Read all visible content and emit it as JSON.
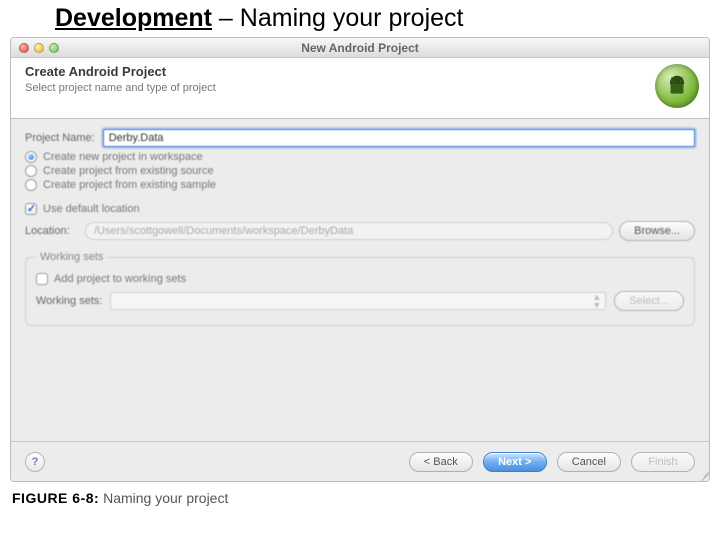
{
  "slide": {
    "title_underline": "Development",
    "title_rest": " – Naming your project"
  },
  "window": {
    "title": "New Android Project"
  },
  "header": {
    "heading": "Create Android Project",
    "subheading": "Select project name and type of project",
    "icon_name": "android-icon"
  },
  "form": {
    "project_name_label": "Project Name:",
    "project_name_value": "Derby.Data",
    "radio_options": [
      {
        "label": "Create new project in workspace",
        "selected": true
      },
      {
        "label": "Create project from existing source",
        "selected": false
      },
      {
        "label": "Create project from existing sample",
        "selected": false
      }
    ],
    "use_default_location_label": "Use default location",
    "use_default_location_checked": true,
    "location_label": "Location:",
    "location_value": "/Users/scottgowell/Documents/workspace/DerbyData",
    "browse_label": "Browse...",
    "working_sets_legend": "Working sets",
    "add_working_sets_label": "Add project to working sets",
    "add_working_sets_checked": false,
    "working_sets_row_label": "Working sets:",
    "select_label": "Select..."
  },
  "footer": {
    "help_label": "?",
    "back_label": "< Back",
    "next_label": "Next >",
    "cancel_label": "Cancel",
    "finish_label": "Finish"
  },
  "caption": {
    "fig": "FIGURE 6-8:",
    "text": " Naming your project"
  }
}
